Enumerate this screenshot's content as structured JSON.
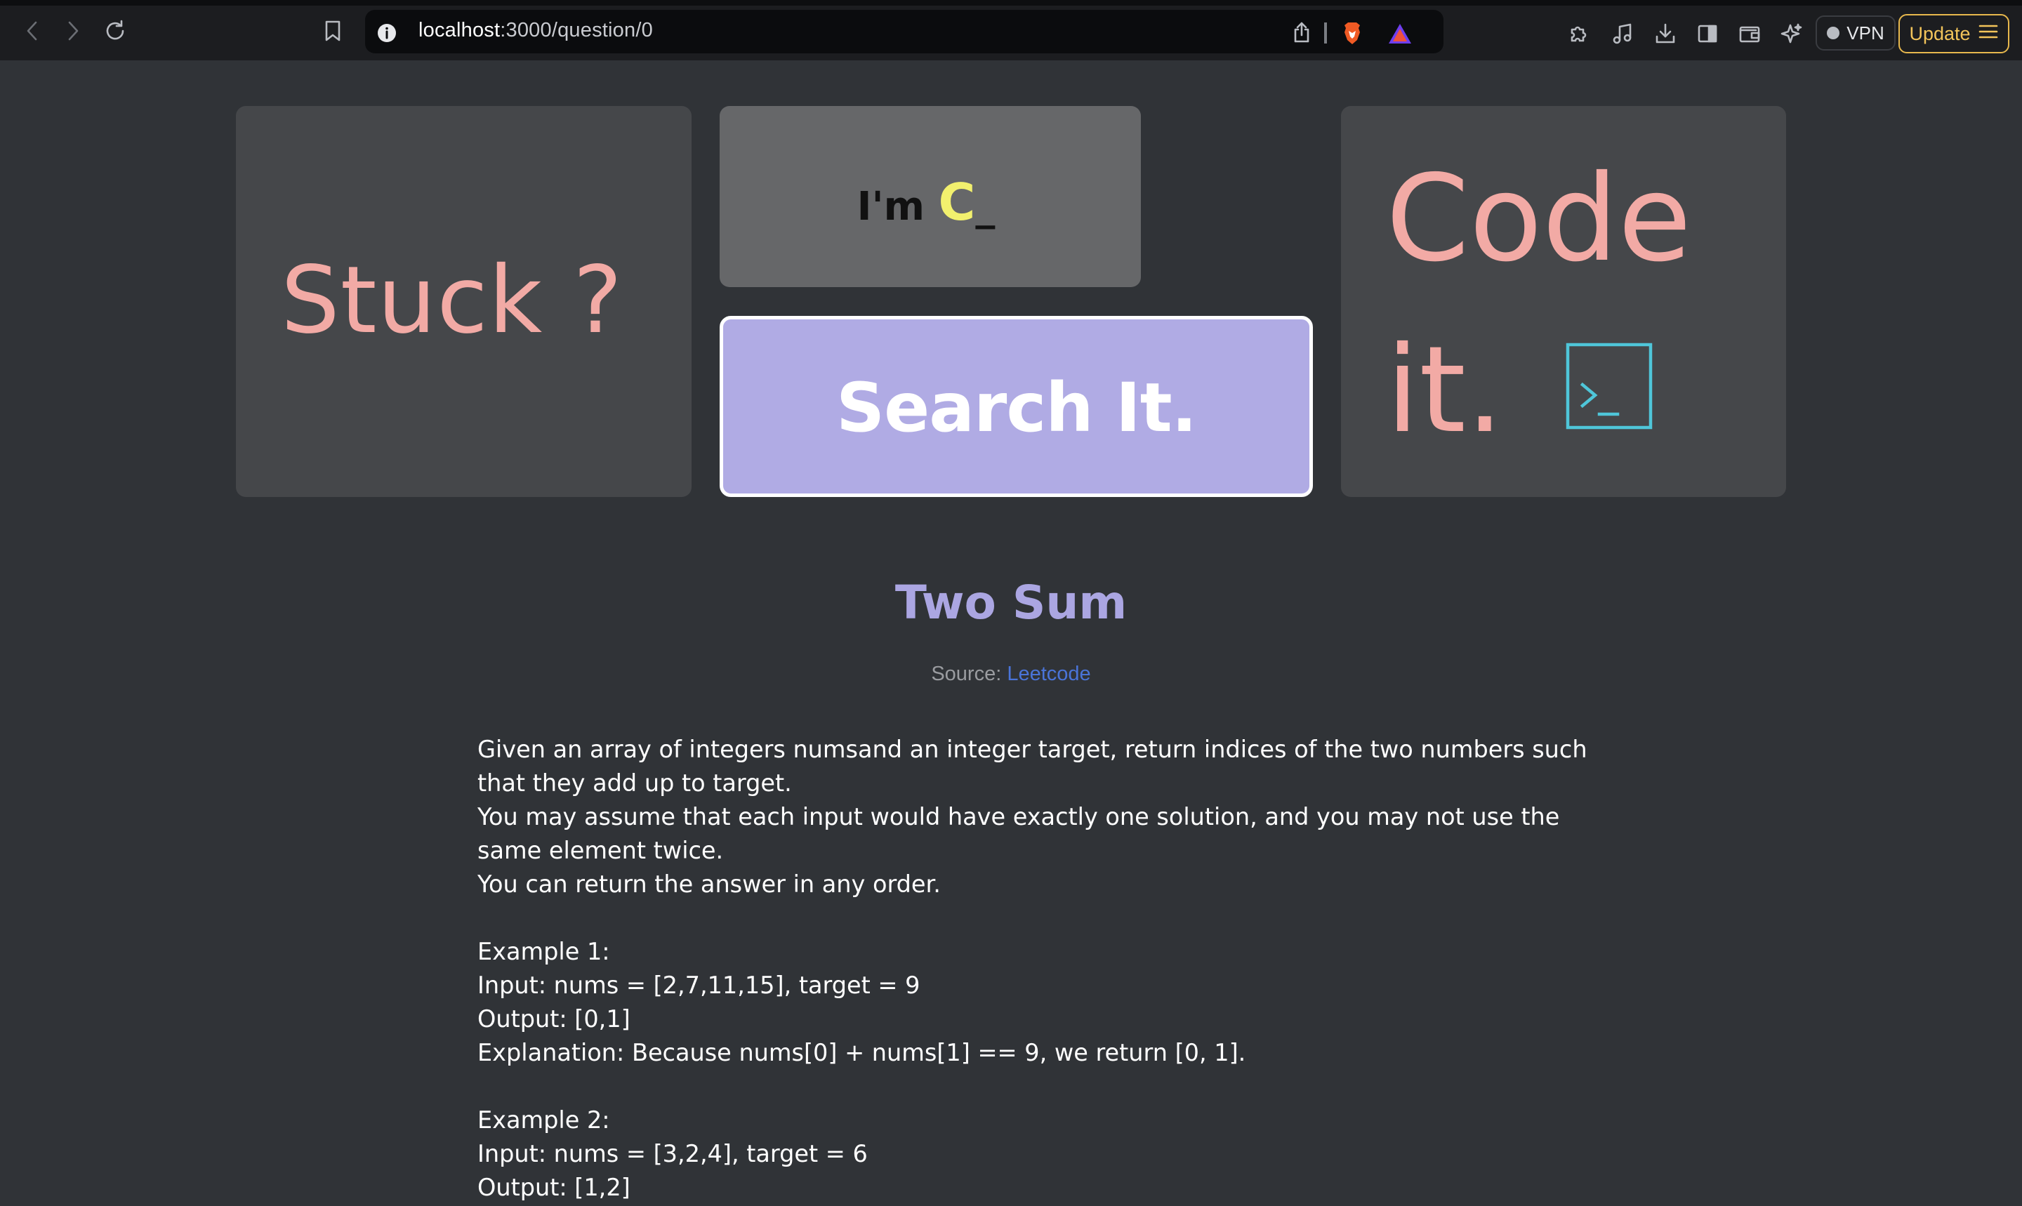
{
  "browser": {
    "url_host": "localhost",
    "url_path": ":3000/question/0",
    "vpn_label": "VPN",
    "update_label": "Update"
  },
  "hero": {
    "stuck": "Stuck ?",
    "im_prefix": "I'm ",
    "im_c": "C",
    "im_cursor": "_",
    "search": "Search It.",
    "code_line1": "Code",
    "code_line2": "it."
  },
  "question": {
    "title": "Two Sum",
    "source_label": "Source: ",
    "source_link": "Leetcode",
    "lines": [
      "Given an array of integers numsand an integer target, return indices of the two numbers such",
      "that they add up to target.",
      "You may assume that each input would have exactly one solution, and you may not use the",
      "same element twice.",
      "You can return the answer in any order."
    ],
    "example1": [
      "Example 1:",
      "Input: nums = [2,7,11,15], target = 9",
      "Output: [0,1]",
      "Explanation: Because nums[0] + nums[1] == 9, we return [0, 1]."
    ],
    "example2": [
      "Example 2:",
      "Input: nums = [3,2,4], target = 6",
      "Output: [1,2]"
    ]
  },
  "colors": {
    "page_bg": "#303337",
    "card_bg": "#45474a",
    "accent_pink": "#f2aaa5",
    "accent_purple": "#aba6e2",
    "search_bg": "#b0abe4",
    "c_yellow": "#f2f06e",
    "link_blue": "#4a74d8",
    "terminal_cyan": "#4fc6d9"
  },
  "icons": [
    "back-icon",
    "forward-icon",
    "reload-icon",
    "bookmark-icon",
    "info-icon",
    "share-icon",
    "brave-shield-icon",
    "brave-rewards-icon",
    "extensions-icon",
    "music-icon",
    "download-icon",
    "sidebar-icon",
    "wallet-icon",
    "leo-icon",
    "menu-icon",
    "terminal-icon"
  ]
}
